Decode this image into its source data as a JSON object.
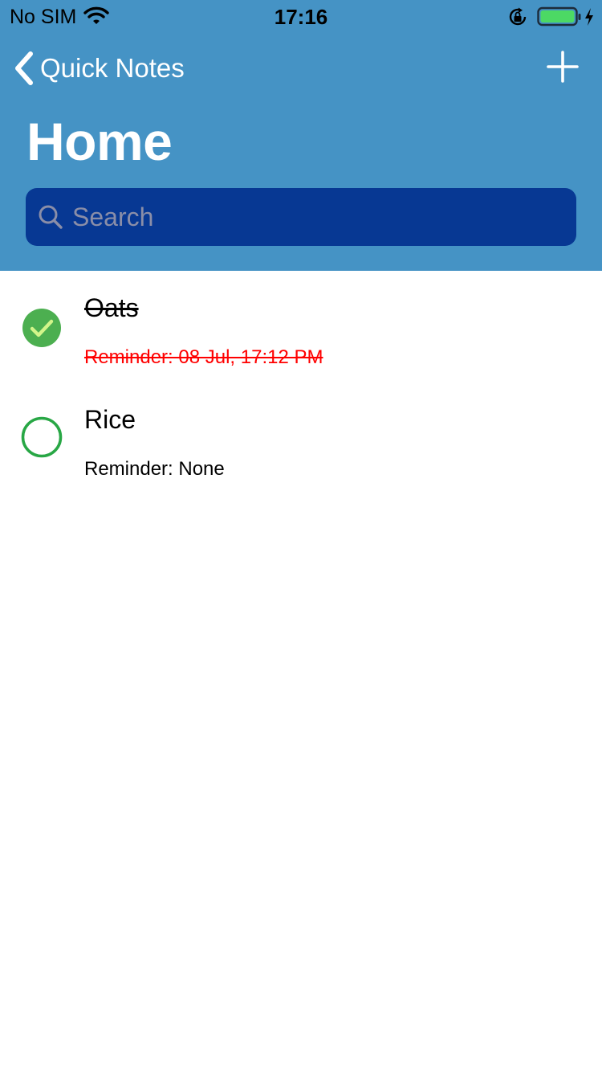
{
  "status_bar": {
    "carrier": "No SIM",
    "time": "17:16",
    "icons": [
      "wifi-icon",
      "lock-rotation-icon",
      "battery-icon",
      "charging-bolt-icon"
    ]
  },
  "nav": {
    "back_label": "Quick Notes",
    "add_icon": "plus-icon",
    "title": "Home"
  },
  "search": {
    "placeholder": "Search",
    "value": ""
  },
  "notes": [
    {
      "title": "Oats",
      "reminder": "Reminder: 08 Jul, 17:12 PM",
      "completed": true
    },
    {
      "title": "Rice",
      "reminder": "Reminder: None",
      "completed": false
    }
  ],
  "colors": {
    "header_bg": "#4593c5",
    "search_bg": "#073893",
    "done_green": "#4caf50",
    "check_mark": "#d2f58a",
    "pending_ring": "#28a745",
    "overdue_red": "#ff0000",
    "battery_green": "#4cd964"
  }
}
